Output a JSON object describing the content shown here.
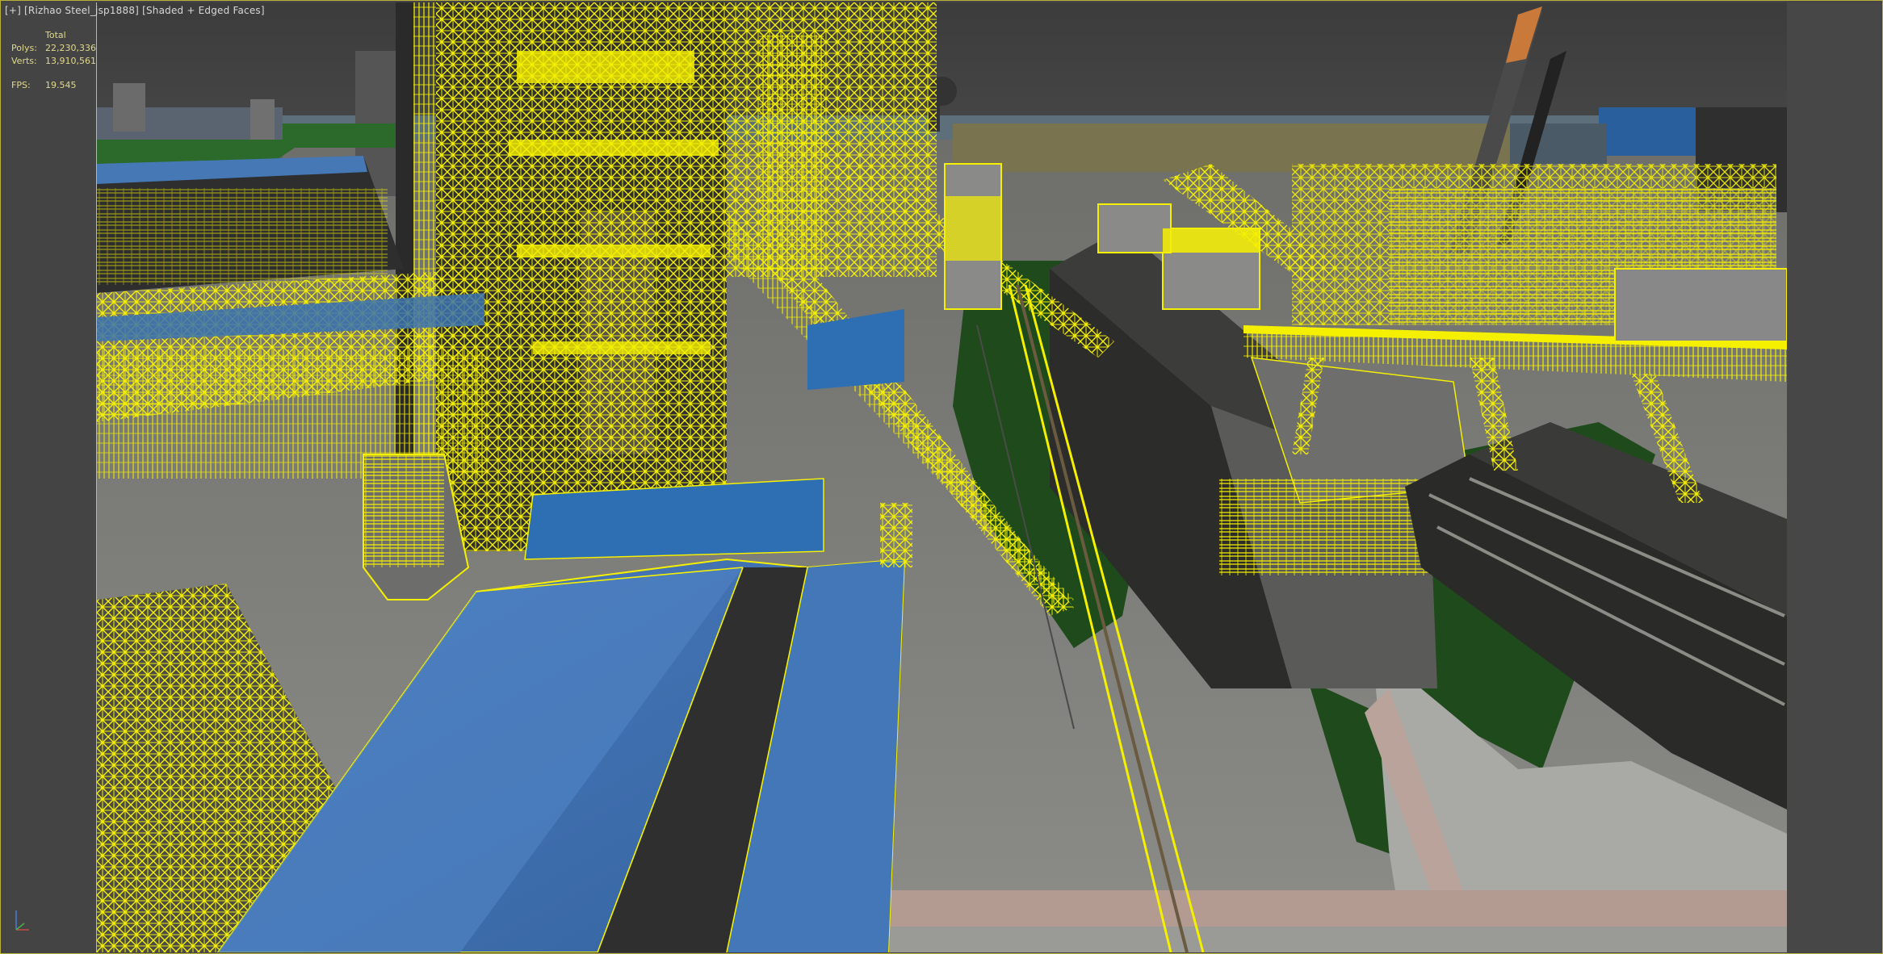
{
  "viewport": {
    "label_menu": "[+]",
    "label_camera": "[Rizhao Steel_jsp1888]",
    "label_shading": "[Shaded + Edged Faces]"
  },
  "stats": {
    "header": "Total",
    "polys_label": "Polys:",
    "polys_value": "22,230,336",
    "verts_label": "Verts:",
    "verts_value": "13,910,561",
    "fps_label": "FPS:",
    "fps_value": "19.545"
  },
  "colors": {
    "wireframe": "#f5f000",
    "roof_blue": "#3f6fb0",
    "ground_grey": "#8a8a86",
    "grass_green": "#1f4a1c",
    "background": "#444444"
  },
  "icons": {
    "axis": "axis-tripod-icon"
  }
}
